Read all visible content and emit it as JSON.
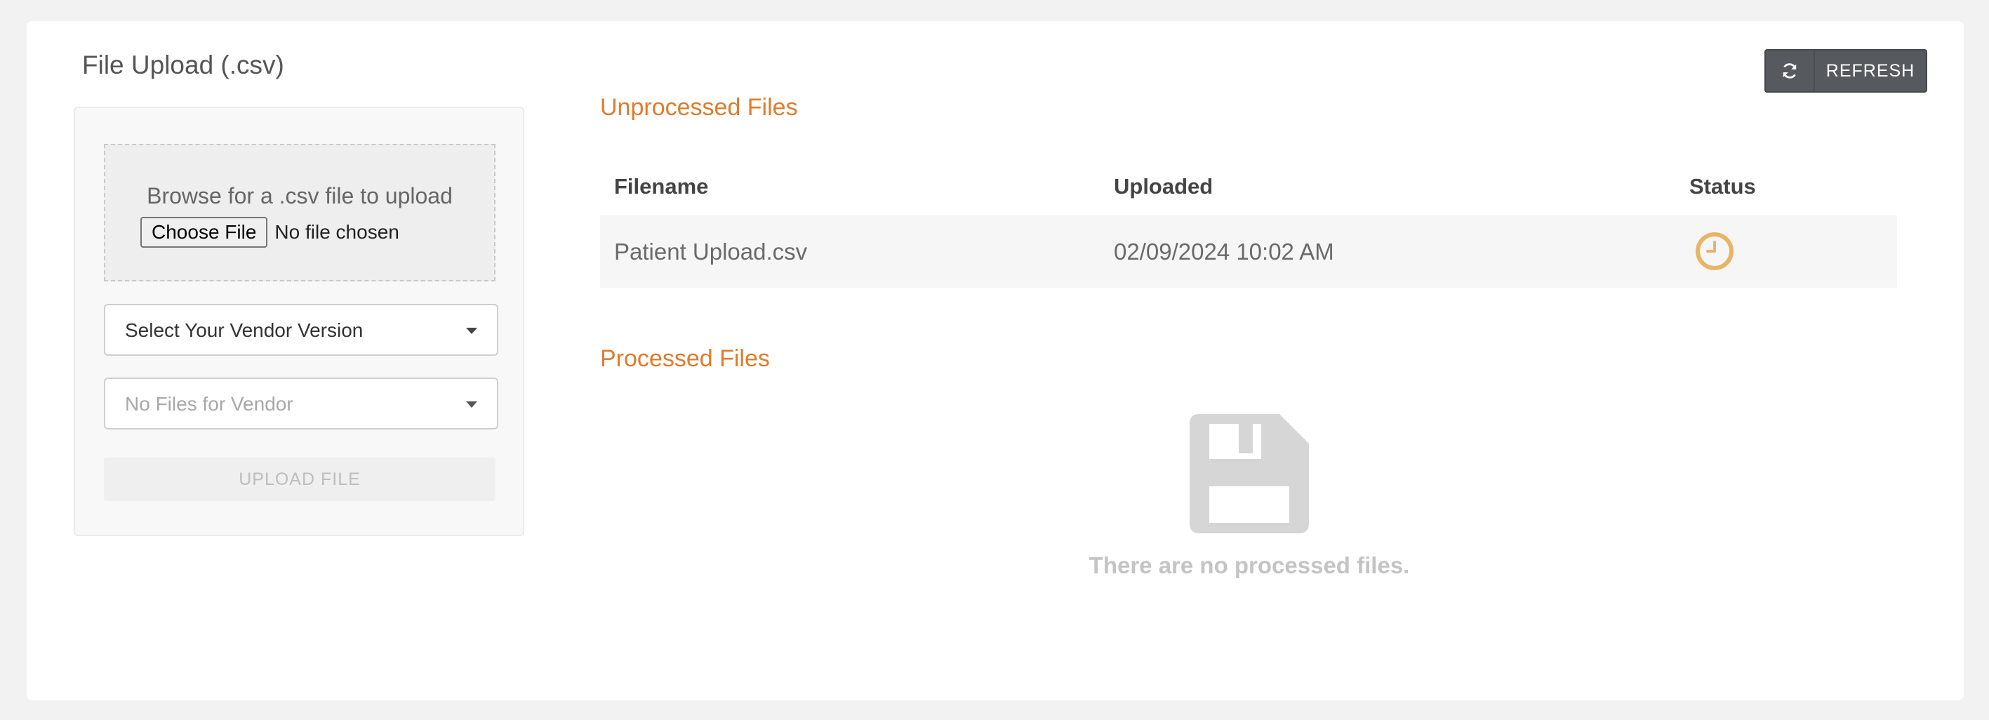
{
  "page": {
    "title": "File Upload (.csv)"
  },
  "upload_panel": {
    "dropzone_text": "Browse for a .csv file to upload",
    "choose_file_label": "Choose File",
    "no_file_text": "No file chosen",
    "vendor_select": {
      "selected": "Select Your Vendor Version"
    },
    "files_select": {
      "selected": "No Files for Vendor"
    },
    "upload_button_label": "UPLOAD FILE"
  },
  "toolbar": {
    "refresh_label": "REFRESH",
    "refresh_icon": "refresh-icon"
  },
  "unprocessed": {
    "title": "Unprocessed Files",
    "columns": [
      "Filename",
      "Uploaded",
      "Status"
    ],
    "rows": [
      {
        "filename": "Patient Upload.csv",
        "uploaded": "02/09/2024 10:02 AM",
        "status_icon": "clock-icon"
      }
    ]
  },
  "processed": {
    "title": "Processed Files",
    "empty_icon": "floppy-disk-icon",
    "empty_text": "There are no processed files."
  },
  "colors": {
    "accent": "#e07b2c",
    "status_pending": "#e9b466",
    "button_dark": "#565a5e",
    "background": "#f2f2f2"
  }
}
